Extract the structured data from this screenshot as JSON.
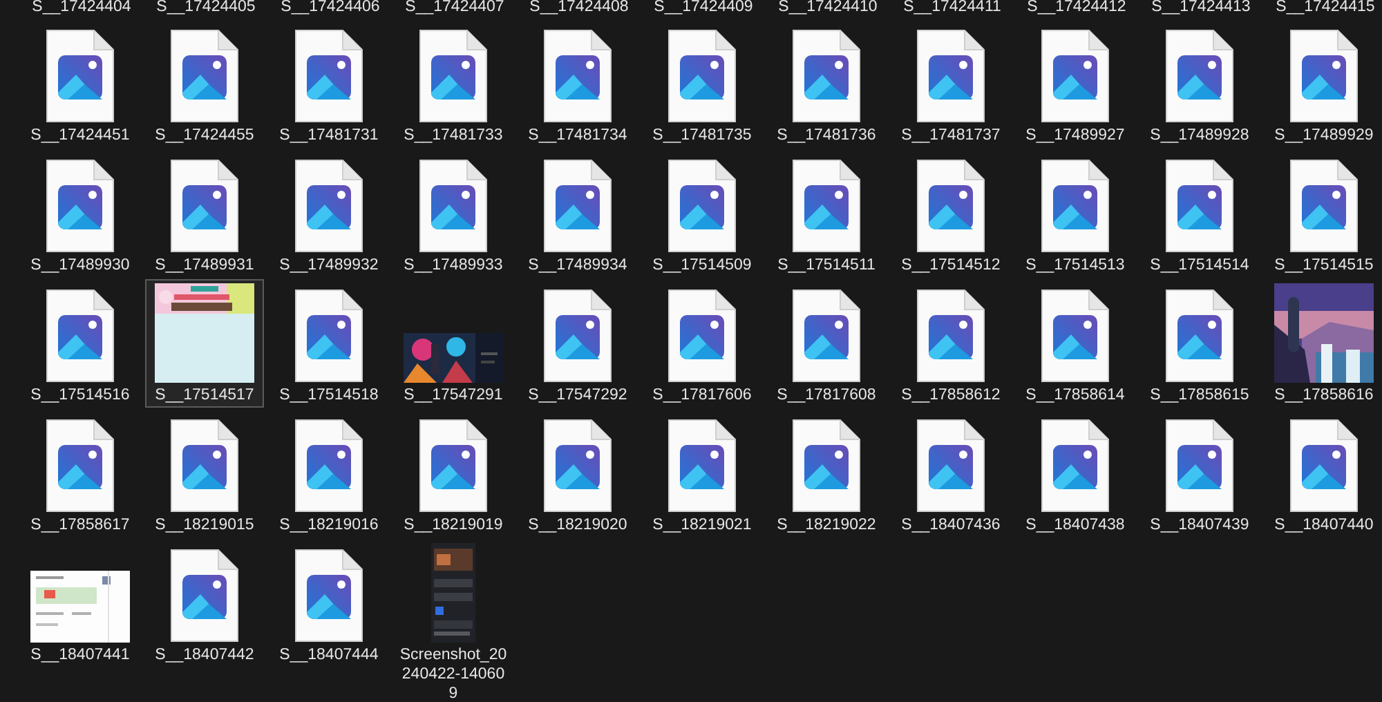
{
  "partial_row": [
    "S__17424404",
    "S__17424405",
    "S__17424406",
    "S__17424407",
    "S__17424408",
    "S__17424409",
    "S__17424410",
    "S__17424411",
    "S__17424412",
    "S__17424413",
    "S__17424415"
  ],
  "files": [
    {
      "name": "S__17424451",
      "kind": "image-file",
      "selected": false
    },
    {
      "name": "S__17424455",
      "kind": "image-file",
      "selected": false
    },
    {
      "name": "S__17481731",
      "kind": "image-file",
      "selected": false
    },
    {
      "name": "S__17481733",
      "kind": "image-file",
      "selected": false
    },
    {
      "name": "S__17481734",
      "kind": "image-file",
      "selected": false
    },
    {
      "name": "S__17481735",
      "kind": "image-file",
      "selected": false
    },
    {
      "name": "S__17481736",
      "kind": "image-file",
      "selected": false
    },
    {
      "name": "S__17481737",
      "kind": "image-file",
      "selected": false
    },
    {
      "name": "S__17489927",
      "kind": "image-file",
      "selected": false
    },
    {
      "name": "S__17489928",
      "kind": "image-file",
      "selected": false
    },
    {
      "name": "S__17489929",
      "kind": "image-file",
      "selected": false
    },
    {
      "name": "S__17489930",
      "kind": "image-file",
      "selected": false
    },
    {
      "name": "S__17489931",
      "kind": "image-file",
      "selected": false
    },
    {
      "name": "S__17489932",
      "kind": "image-file",
      "selected": false
    },
    {
      "name": "S__17489933",
      "kind": "image-file",
      "selected": false
    },
    {
      "name": "S__17489934",
      "kind": "image-file",
      "selected": false
    },
    {
      "name": "S__17514509",
      "kind": "image-file",
      "selected": false
    },
    {
      "name": "S__17514511",
      "kind": "image-file",
      "selected": false
    },
    {
      "name": "S__17514512",
      "kind": "image-file",
      "selected": false
    },
    {
      "name": "S__17514513",
      "kind": "image-file",
      "selected": false
    },
    {
      "name": "S__17514514",
      "kind": "image-file",
      "selected": false
    },
    {
      "name": "S__17514515",
      "kind": "image-file",
      "selected": false
    },
    {
      "name": "S__17514516",
      "kind": "image-file",
      "selected": false
    },
    {
      "name": "S__17514517",
      "kind": "picture",
      "selected": true
    },
    {
      "name": "S__17514518",
      "kind": "image-file",
      "selected": false
    },
    {
      "name": "S__17547291",
      "kind": "picture",
      "selected": false
    },
    {
      "name": "S__17547292",
      "kind": "image-file",
      "selected": false
    },
    {
      "name": "S__17817606",
      "kind": "image-file",
      "selected": false
    },
    {
      "name": "S__17817608",
      "kind": "image-file",
      "selected": false
    },
    {
      "name": "S__17858612",
      "kind": "image-file",
      "selected": false
    },
    {
      "name": "S__17858614",
      "kind": "image-file",
      "selected": false
    },
    {
      "name": "S__17858615",
      "kind": "image-file",
      "selected": false
    },
    {
      "name": "S__17858616",
      "kind": "picture",
      "selected": false
    },
    {
      "name": "S__17858617",
      "kind": "image-file",
      "selected": false
    },
    {
      "name": "S__18219015",
      "kind": "image-file",
      "selected": false
    },
    {
      "name": "S__18219016",
      "kind": "image-file",
      "selected": false
    },
    {
      "name": "S__18219019",
      "kind": "image-file",
      "selected": false
    },
    {
      "name": "S__18219020",
      "kind": "image-file",
      "selected": false
    },
    {
      "name": "S__18219021",
      "kind": "image-file",
      "selected": false
    },
    {
      "name": "S__18219022",
      "kind": "image-file",
      "selected": false
    },
    {
      "name": "S__18407436",
      "kind": "image-file",
      "selected": false
    },
    {
      "name": "S__18407438",
      "kind": "image-file",
      "selected": false
    },
    {
      "name": "S__18407439",
      "kind": "image-file",
      "selected": false
    },
    {
      "name": "S__18407440",
      "kind": "image-file",
      "selected": false
    },
    {
      "name": "S__18407441",
      "kind": "picture",
      "selected": false
    },
    {
      "name": "S__18407442",
      "kind": "image-file",
      "selected": false
    },
    {
      "name": "S__18407444",
      "kind": "image-file",
      "selected": false
    },
    {
      "name": "Screenshot_20240422-140609",
      "kind": "picture",
      "selected": false
    }
  ]
}
